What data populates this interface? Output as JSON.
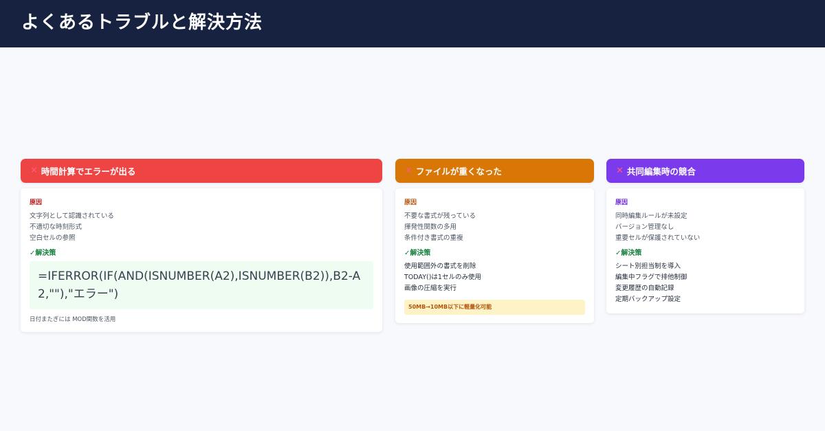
{
  "page": {
    "title": "よくあるトラブルと解決方法"
  },
  "cards": [
    {
      "title": "時間計算でエラーが出る",
      "header_color": "#ef4444",
      "cause_label": "原因",
      "cause_color": "#b91c1c",
      "causes": [
        "文字列として認識されている",
        "不適切な時刻形式",
        "空白セルの参照"
      ],
      "solution_label": "✓解決策",
      "formula": "=IFERROR(IF(AND(ISNUMBER(A2),ISNUMBER(B2)),B2-A2,\"\"),\"エラー\")",
      "note": "日付またぎには MOD関数を活用"
    },
    {
      "title": "ファイルが重くなった",
      "header_color": "#d97706",
      "cause_label": "原因",
      "cause_color": "#b45309",
      "causes": [
        "不要な書式が残っている",
        "揮発性関数の多用",
        "条件付き書式の重複"
      ],
      "solution_label": "✓解決策",
      "solutions": [
        "使用範囲外の書式を削除",
        "TODAY()は1セルのみ使用",
        "画像の圧縮を実行"
      ],
      "highlight": "50MB→10MB以下に軽量化可能"
    },
    {
      "title": "共同編集時の競合",
      "header_color": "#7c3aed",
      "cause_label": "原因",
      "cause_color": "#6d28d9",
      "causes": [
        "同時編集ルールが未設定",
        "バージョン管理なし",
        "重要セルが保護されていない"
      ],
      "solution_label": "✓解決策",
      "solutions": [
        "シート別担当制を導入",
        "編集中フラグで排他制御",
        "変更履歴の自動記録",
        "定期バックアップ設定"
      ]
    }
  ],
  "icons": {
    "problem": "x-mark-icon"
  }
}
